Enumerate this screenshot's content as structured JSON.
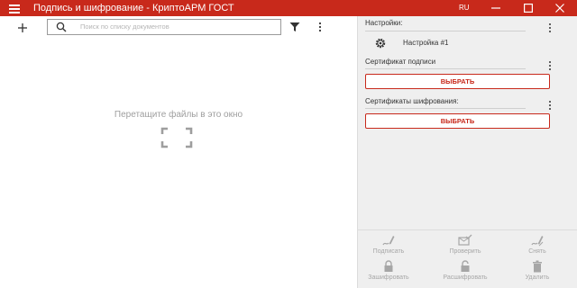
{
  "app": {
    "title": "Подпись и шифрование - КриптоАРМ ГОСТ",
    "language": "RU",
    "accent_color": "#c8291b"
  },
  "documents_pane": {
    "search": {
      "placeholder": "Поиск по списку документов",
      "value": ""
    },
    "drop_hint": "Перетащите файлы в это окно"
  },
  "settings_pane": {
    "settings_label": "Настройки:",
    "setting_name": "Настройка #1",
    "sign_cert_label": "Сертификат подписи",
    "sign_cert_button": "ВЫБРАТЬ",
    "enc_cert_label": "Сертификаты шифрования:",
    "enc_cert_button": "ВЫБРАТЬ"
  },
  "actions": {
    "sign": "Подписать",
    "verify": "Проверить",
    "unsign": "Снять",
    "encrypt": "Зашифровать",
    "decrypt": "Расшифровать",
    "delete": "Удалить"
  }
}
